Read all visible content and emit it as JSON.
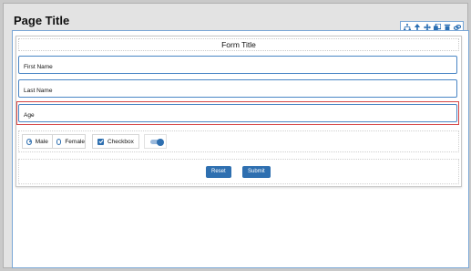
{
  "page": {
    "title": "Page Title"
  },
  "toolbar": {
    "icons": [
      "sitemap-icon",
      "arrow-up-icon",
      "move-icon",
      "copy-icon",
      "trash-icon",
      "link-icon"
    ]
  },
  "form": {
    "title": "Form Title",
    "fields": [
      {
        "placeholder": "First Name",
        "value": ""
      },
      {
        "placeholder": "Last Name",
        "value": ""
      },
      {
        "placeholder": "Age",
        "value": ""
      }
    ],
    "radio": {
      "options": [
        {
          "label": "Male",
          "selected": true
        },
        {
          "label": "Female",
          "selected": false
        }
      ]
    },
    "checkbox": {
      "label": "Checkbox",
      "checked": true
    },
    "toggle": {
      "on": true
    },
    "buttons": {
      "reset": "Reset",
      "submit": "Submit"
    }
  },
  "colors": {
    "accent": "#2e6fb0",
    "selected_outline": "#d64545",
    "field_border": "#4a86c5"
  }
}
